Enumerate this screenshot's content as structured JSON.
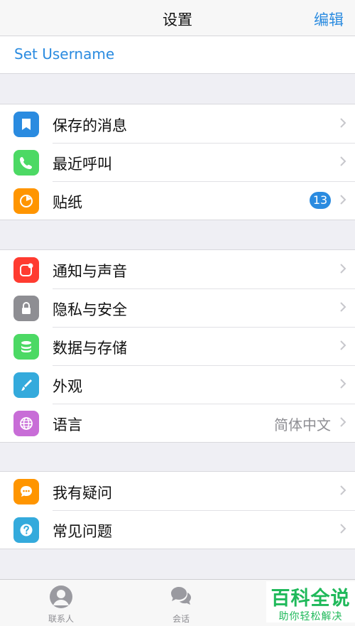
{
  "header": {
    "title": "设置",
    "edit_label": "编辑"
  },
  "username": {
    "label": "Set Username"
  },
  "groups": [
    [
      {
        "label": "保存的消息",
        "icon": "bookmark-icon",
        "color": "#2a8be0"
      },
      {
        "label": "最近呼叫",
        "icon": "phone-icon",
        "color": "#4cd964"
      },
      {
        "label": "贴纸",
        "icon": "sticker-icon",
        "color": "#ff9500",
        "badge": "13"
      }
    ],
    [
      {
        "label": "通知与声音",
        "icon": "notification-icon",
        "color": "#ff3b30"
      },
      {
        "label": "隐私与安全",
        "icon": "lock-icon",
        "color": "#8e8e93"
      },
      {
        "label": "数据与存储",
        "icon": "database-icon",
        "color": "#4cd964"
      },
      {
        "label": "外观",
        "icon": "brush-icon",
        "color": "#34aadc"
      },
      {
        "label": "语言",
        "icon": "globe-icon",
        "color": "#c86dd7",
        "detail": "简体中文"
      }
    ],
    [
      {
        "label": "我有疑问",
        "icon": "chat-bubble-icon",
        "color": "#ff9500"
      },
      {
        "label": "常见问题",
        "icon": "question-icon",
        "color": "#34aadc"
      }
    ]
  ],
  "tabs": [
    {
      "label": "联系人",
      "icon": "contacts-icon"
    },
    {
      "label": "会话",
      "icon": "chats-icon"
    }
  ],
  "watermark": {
    "logo": "百科全说",
    "sub": "助你轻松解决"
  }
}
